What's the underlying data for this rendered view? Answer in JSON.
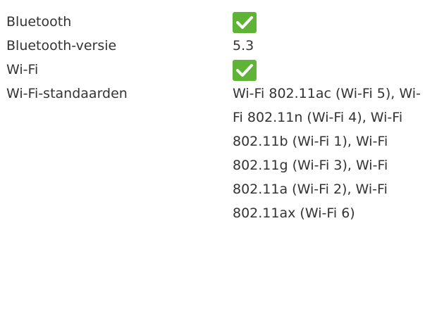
{
  "specs": [
    {
      "label": "Bluetooth",
      "value": "",
      "check": true
    },
    {
      "label": "Bluetooth-versie",
      "value": "5.3",
      "check": false
    },
    {
      "label": "Wi-Fi",
      "value": "",
      "check": true
    },
    {
      "label": "Wi-Fi-standaarden",
      "value": "Wi-Fi 802.11ac (Wi-Fi 5), Wi-Fi 802.11n (Wi-Fi 4), Wi-Fi 802.11b (Wi-Fi 1), Wi-Fi 802.11g (Wi-Fi 3), Wi-Fi 802.11a (Wi-Fi 2), Wi-Fi 802.11ax (Wi-Fi 6)",
      "check": false
    }
  ],
  "colors": {
    "text": "#333333",
    "check_bg": "#5fb437",
    "check_mark": "#ffffff"
  },
  "icons": {
    "check": "checkmark-icon"
  }
}
